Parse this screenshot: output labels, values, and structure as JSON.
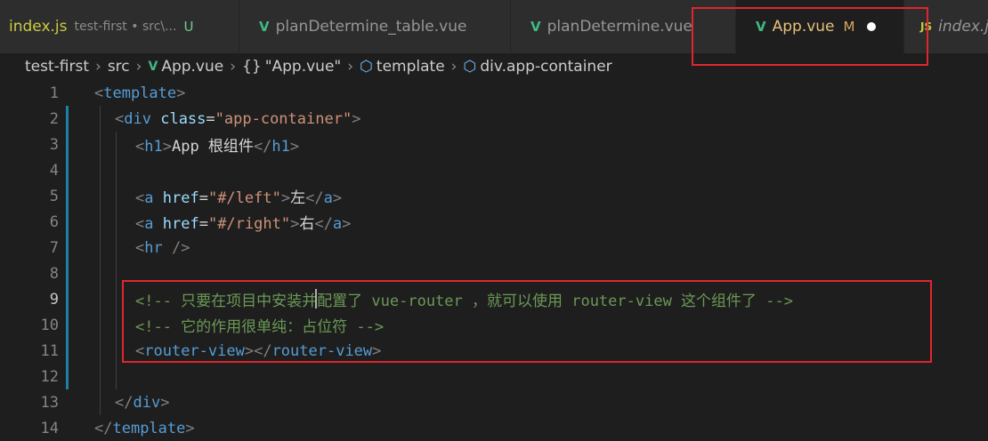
{
  "tabs": [
    {
      "label": "index.js",
      "sub": "test-first • src\\...",
      "badge": "U",
      "icon": "js-icon"
    },
    {
      "label": "planDetermine_table.vue",
      "icon": "vue-icon"
    },
    {
      "label": "planDetermine.vue",
      "icon": "vue-icon"
    },
    {
      "label": "App.vue",
      "badge": "M",
      "icon": "vue-icon",
      "active": true
    },
    {
      "label": "index.js",
      "icon": "js-icon",
      "icon_text": "JS"
    }
  ],
  "breadcrumb": {
    "root": "test-first",
    "folder": "src",
    "file": "App.vue",
    "braces": "{}",
    "module": "\"App.vue\"",
    "template": "template",
    "element": "div.app-container"
  },
  "line_numbers": [
    "1",
    "2",
    "3",
    "4",
    "5",
    "6",
    "7",
    "8",
    "9",
    "10",
    "11",
    "12",
    "13",
    "14"
  ],
  "code": {
    "l1_open": "<",
    "l1_tag": "template",
    "l1_close": ">",
    "l2_open": "<",
    "l2_tag": "div",
    "l2_attr": "class",
    "l2_eq": "=",
    "l2_val": "\"app-container\"",
    "l2_close": ">",
    "l3_open": "<",
    "l3_tag": "h1",
    "l3_close": ">",
    "l3_text": "App 根组件",
    "l3_end_open": "</",
    "l3_end_tag": "h1",
    "l3_end_close": ">",
    "l5_open": "<",
    "l5_tag": "a",
    "l5_attr": "href",
    "l5_eq": "=",
    "l5_val": "\"#/left\"",
    "l5_close": ">",
    "l5_text": "左",
    "l5_end_open": "</",
    "l5_end_tag": "a",
    "l5_end_close": ">",
    "l6_open": "<",
    "l6_tag": "a",
    "l6_attr": "href",
    "l6_eq": "=",
    "l6_val": "\"#/right\"",
    "l6_close": ">",
    "l6_text": "右",
    "l6_end_open": "</",
    "l6_end_tag": "a",
    "l6_end_close": ">",
    "l7_open": "<",
    "l7_tag": "hr",
    "l7_close": " />",
    "l9_comment": "<!-- 只要在项目中安装并配置了 vue-router ，就可以使用 router-view 这个组件了 -->",
    "l10_comment": "<!-- 它的作用很单纯：占位符 -->",
    "l11_open": "<",
    "l11_tag": "router-view",
    "l11_mid": "></",
    "l11_tag2": "router-view",
    "l11_close": ">",
    "l13_open": "</",
    "l13_tag": "div",
    "l13_close": ">",
    "l14_open": "</",
    "l14_tag": "template",
    "l14_close": ">"
  },
  "colors": {
    "highlight_box": "#e0262d",
    "comment": "#6a9955",
    "tag": "#569cd6",
    "attribute": "#9cdcfe",
    "string": "#ce9178"
  }
}
